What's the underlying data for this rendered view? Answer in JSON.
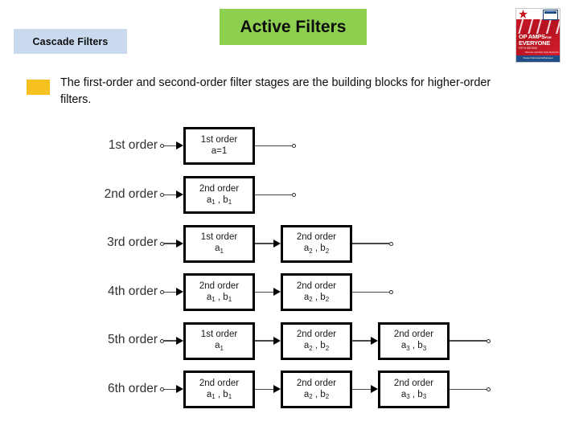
{
  "header": {
    "section_tab": "Cascade Filters",
    "title": "Active Filters",
    "book": {
      "logo": "elsevier-tree-icon",
      "title_line1": "OP AMPS",
      "title_line1_small": "FOR",
      "title_line2": "EVERYONE",
      "edition": "FIFTH EDITION",
      "authors": "BRUCE CARTER\nRON MANCINI",
      "publisher": "Texas Instruments/Newnes"
    }
  },
  "bullet": {
    "marker_color": "#f5c020",
    "text": "The first-order and second-order filter stages are the building blocks for higher-order filters."
  },
  "colors": {
    "tab_background": "#c9d9ee",
    "title_background": "#8dd04f",
    "bullet_marker": "#f5c020",
    "box_border": "#000000",
    "wire": "#4a4a4a"
  },
  "diagram": {
    "rows": [
      {
        "label": "1st order",
        "stages": [
          {
            "order": "1st order",
            "coeffs": "a=1",
            "coeffs_html": "a=1"
          }
        ]
      },
      {
        "label": "2nd order",
        "stages": [
          {
            "order": "2nd order",
            "coeffs": "a1 , b1",
            "coeffs_html": "a<sub>1</sub> , b<sub>1</sub>"
          }
        ]
      },
      {
        "label": "3rd order",
        "stages": [
          {
            "order": "1st order",
            "coeffs": "a1",
            "coeffs_html": "a<sub>1</sub>"
          },
          {
            "order": "2nd order",
            "coeffs": "a2 , b2",
            "coeffs_html": "a<sub>2</sub> , b<sub>2</sub>"
          }
        ]
      },
      {
        "label": "4th order",
        "stages": [
          {
            "order": "2nd order",
            "coeffs": "a1 , b1",
            "coeffs_html": "a<sub>1</sub> , b<sub>1</sub>"
          },
          {
            "order": "2nd order",
            "coeffs": "a2 , b2",
            "coeffs_html": "a<sub>2</sub> , b<sub>2</sub>"
          }
        ]
      },
      {
        "label": "5th order",
        "stages": [
          {
            "order": "1st order",
            "coeffs": "a1",
            "coeffs_html": "a<sub>1</sub>"
          },
          {
            "order": "2nd order",
            "coeffs": "a2 , b2",
            "coeffs_html": "a<sub>2</sub> , b<sub>2</sub>"
          },
          {
            "order": "2nd order",
            "coeffs": "a3 , b3",
            "coeffs_html": "a<sub>3</sub> , b<sub>3</sub>"
          }
        ]
      },
      {
        "label": "6th order",
        "stages": [
          {
            "order": "2nd order",
            "coeffs": "a1 , b1",
            "coeffs_html": "a<sub>1</sub> , b<sub>1</sub>"
          },
          {
            "order": "2nd order",
            "coeffs": "a2 , b2",
            "coeffs_html": "a<sub>2</sub> , b<sub>2</sub>"
          },
          {
            "order": "2nd order",
            "coeffs": "a3 , b3",
            "coeffs_html": "a<sub>3</sub> , b<sub>3</sub>"
          }
        ]
      }
    ]
  }
}
